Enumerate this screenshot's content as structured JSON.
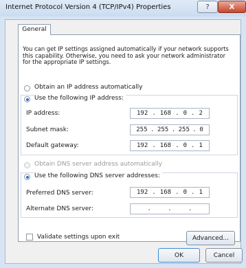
{
  "window": {
    "title": "Internet Protocol Version 4 (TCP/IPv4) Properties",
    "help_glyph": "?",
    "close_glyph": "X"
  },
  "tabs": [
    {
      "label": "General",
      "selected": true
    }
  ],
  "intro_text": "You can get IP settings assigned automatically if your network supports\nthis capability. Otherwise, you need to ask your network administrator\nfor the appropriate IP settings.",
  "ip_section": {
    "auto_label": "Obtain an IP address automatically",
    "manual_label": "Use the following IP address:",
    "selected": "manual",
    "fields": [
      {
        "label": "IP address:",
        "octets": [
          "192",
          "168",
          "0",
          "2"
        ]
      },
      {
        "label": "Subnet mask:",
        "octets": [
          "255",
          "255",
          "255",
          "0"
        ]
      },
      {
        "label": "Default gateway:",
        "octets": [
          "192",
          "168",
          "0",
          "1"
        ]
      }
    ]
  },
  "dns_section": {
    "auto_label": "Obtain DNS server address automatically",
    "manual_label": "Use the following DNS server addresses:",
    "selected": "manual",
    "fields": [
      {
        "label": "Preferred DNS server:",
        "octets": [
          "192",
          "168",
          "0",
          "1"
        ]
      },
      {
        "label": "Alternate DNS server:",
        "octets": [
          "",
          "",
          "",
          ""
        ]
      }
    ]
  },
  "validate": {
    "label": "Validate settings upon exit",
    "checked": false
  },
  "buttons": {
    "advanced": "Advanced...",
    "ok": "OK",
    "cancel": "Cancel"
  }
}
